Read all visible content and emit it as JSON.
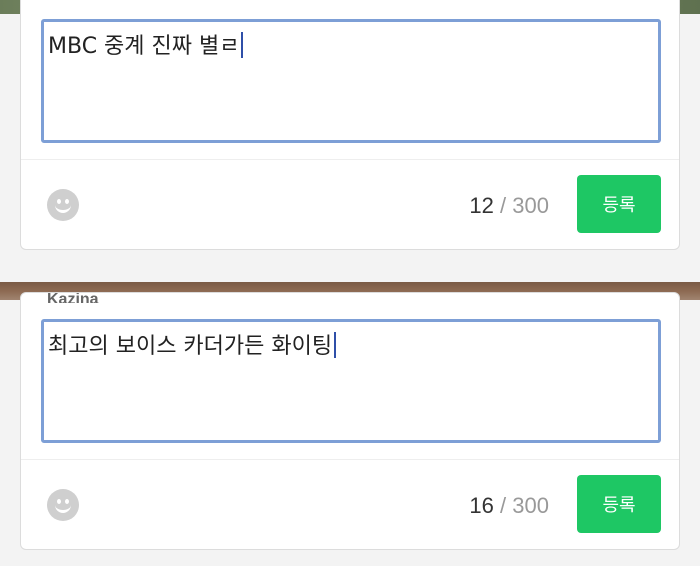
{
  "comments": [
    {
      "username": "",
      "text": "MBC 중계 진짜 별ㄹ",
      "count": "12",
      "max": "300",
      "slash": "/",
      "submit_label": "등록"
    },
    {
      "username": "Kazina",
      "text": "최고의 보이스 카더가든 화이팅",
      "count": "16",
      "max": "300",
      "slash": "/",
      "submit_label": "등록"
    }
  ],
  "icons": {
    "emoji": "smiley-face-icon"
  },
  "colors": {
    "accent": "#1ec764",
    "focus_border": "#7d9fd6"
  }
}
